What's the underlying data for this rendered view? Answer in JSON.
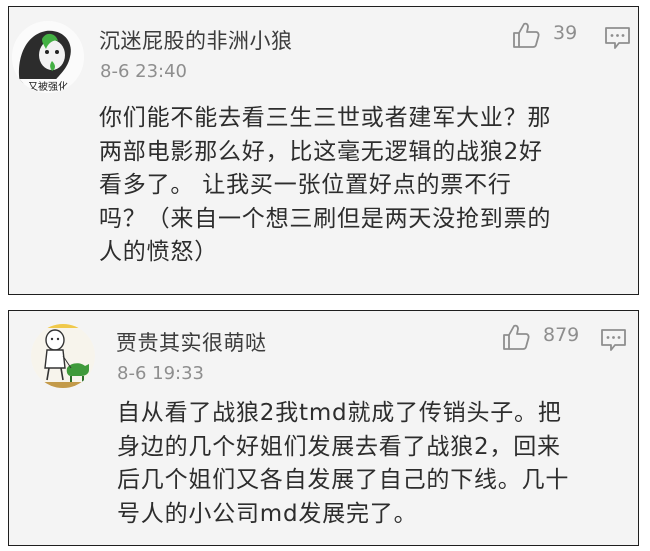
{
  "comments": [
    {
      "username": "沉迷屁股的非洲小狼",
      "avatar_caption": "又被强化",
      "timestamp": "8-6 23:40",
      "likes": "39",
      "text": "你们能不能去看三生三世或者建军大业？那\n两部电影那么好，比这毫无逻辑的战狼2好\n看多了。 让我买一张位置好点的票不行\n吗？（来自一个想三刷但是两天没抢到票的\n人的愤怒）",
      "like_icon": "thumbs-up-icon",
      "comment_icon": "comment-bubble-icon"
    },
    {
      "username": "贾贵其实很萌哒",
      "timestamp": "8-6 19:33",
      "likes": "879",
      "text": "自从看了战狼2我tmd就成了传销头子。把\n身边的几个好姐们发展去看了战狼2，回来\n后几个姐们又各自发展了自己的下线。几十\n号人的小公司md发展完了。",
      "like_icon": "thumbs-up-icon",
      "comment_icon": "comment-bubble-icon"
    }
  ],
  "colors": {
    "card_bg": "#f4f4f4",
    "card_border": "#1f1f1f",
    "username": "#3c3c3c",
    "meta": "#8e8e8e",
    "body": "#2d2d2d"
  }
}
